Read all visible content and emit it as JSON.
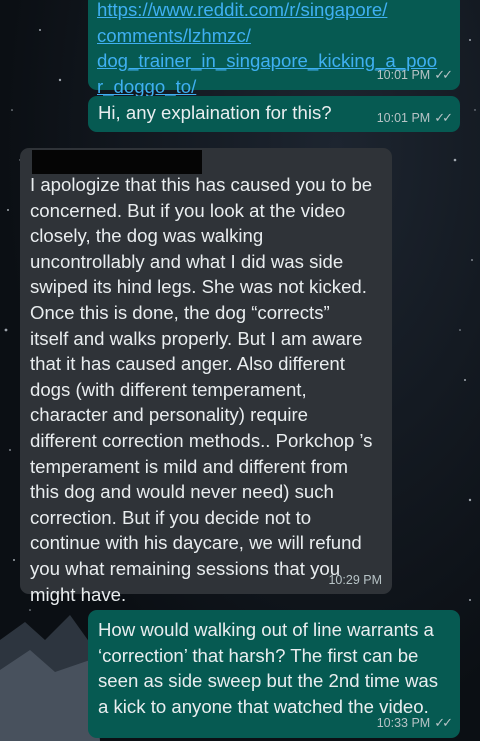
{
  "messages": [
    {
      "direction": "outgoing",
      "link_lines": [
        "https://www.reddit.com/r/singapore/",
        "comments/lzhmzc/",
        "dog_trainer_in_singapore_kicking_a_poo",
        "r_doggo_to/"
      ],
      "time": "10:01 PM",
      "status_icon": "double-check-icon"
    },
    {
      "direction": "outgoing",
      "text": "Hi, any explaination for this?",
      "time": "10:01 PM",
      "status_icon": "double-check-icon"
    },
    {
      "direction": "incoming",
      "sender_redacted": true,
      "lines": [
        "I apologize that this has caused you to be",
        "concerned. But if you look at the video",
        "closely, the dog was walking",
        "uncontrollably and what I did was side",
        "swiped its hind legs. She was not kicked.",
        "Once this is done, the dog “corrects”",
        "itself and walks properly. But I am aware",
        "that it has caused anger. Also different",
        "dogs (with different temperament,",
        "character and personality) require",
        "different correction methods.. Porkchop ’s",
        "temperament is mild and different from",
        "this dog and would never need) such",
        "correction. But if you decide not to",
        "continue with his daycare, we will refund",
        "you what remaining sessions that you",
        "might have."
      ],
      "time": "10:29 PM"
    },
    {
      "direction": "outgoing",
      "lines": [
        "How would walking out of line warrants a",
        "‘correction’ that harsh? The first can be",
        "seen as side sweep but the 2nd time was",
        "a kick to anyone that watched the video."
      ],
      "time": "10:33 PM",
      "status_icon": "double-check-icon"
    }
  ],
  "colors": {
    "outgoing_bubble": "#065a52",
    "incoming_bubble": "#2f3338",
    "link": "#3fb0f2",
    "background": "#0b0f14"
  }
}
